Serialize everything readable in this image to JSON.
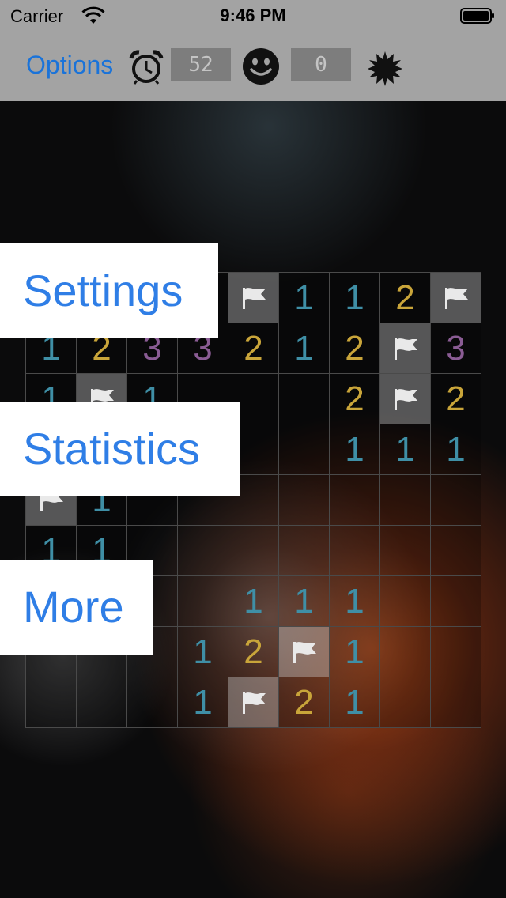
{
  "status_bar": {
    "carrier": "Carrier",
    "time": "9:46 PM"
  },
  "toolbar": {
    "options_label": "Options",
    "timer_value": "52",
    "mine_counter_value": "0",
    "icons": [
      "alarm-clock-icon",
      "smiley-face-icon",
      "mine-icon"
    ]
  },
  "menu": {
    "settings_label": "Settings",
    "statistics_label": "Statistics",
    "more_label": "More"
  },
  "board": {
    "rows": 9,
    "cols": 9,
    "cells": [
      [
        "",
        "",
        "",
        "",
        "F",
        "1",
        "1",
        "2",
        "F"
      ],
      [
        "1",
        "2",
        "3",
        "3",
        "2",
        "1",
        "2",
        "F",
        "3"
      ],
      [
        "1",
        "F",
        "1",
        "",
        "",
        "",
        "2",
        "F",
        "2"
      ],
      [
        "",
        "",
        "",
        "",
        "",
        "",
        "1",
        "1",
        "1"
      ],
      [
        "F",
        "1",
        "",
        "",
        "",
        "",
        "",
        "",
        ""
      ],
      [
        "1",
        "1",
        "",
        "",
        "",
        "",
        "",
        "",
        ""
      ],
      [
        "",
        "",
        "",
        "",
        "1",
        "1",
        "1",
        "",
        ""
      ],
      [
        "",
        "",
        "",
        "1",
        "2",
        "F",
        "1",
        "",
        ""
      ],
      [
        "",
        "",
        "",
        "1",
        "F",
        "2",
        "1",
        "",
        ""
      ]
    ]
  },
  "colors": {
    "toolbar_bg": "#a3a3a3",
    "accent_blue": "#1a73d9",
    "number_1": "#3f8fa6",
    "number_2": "#c9a53a",
    "number_3": "#8a5c94"
  }
}
